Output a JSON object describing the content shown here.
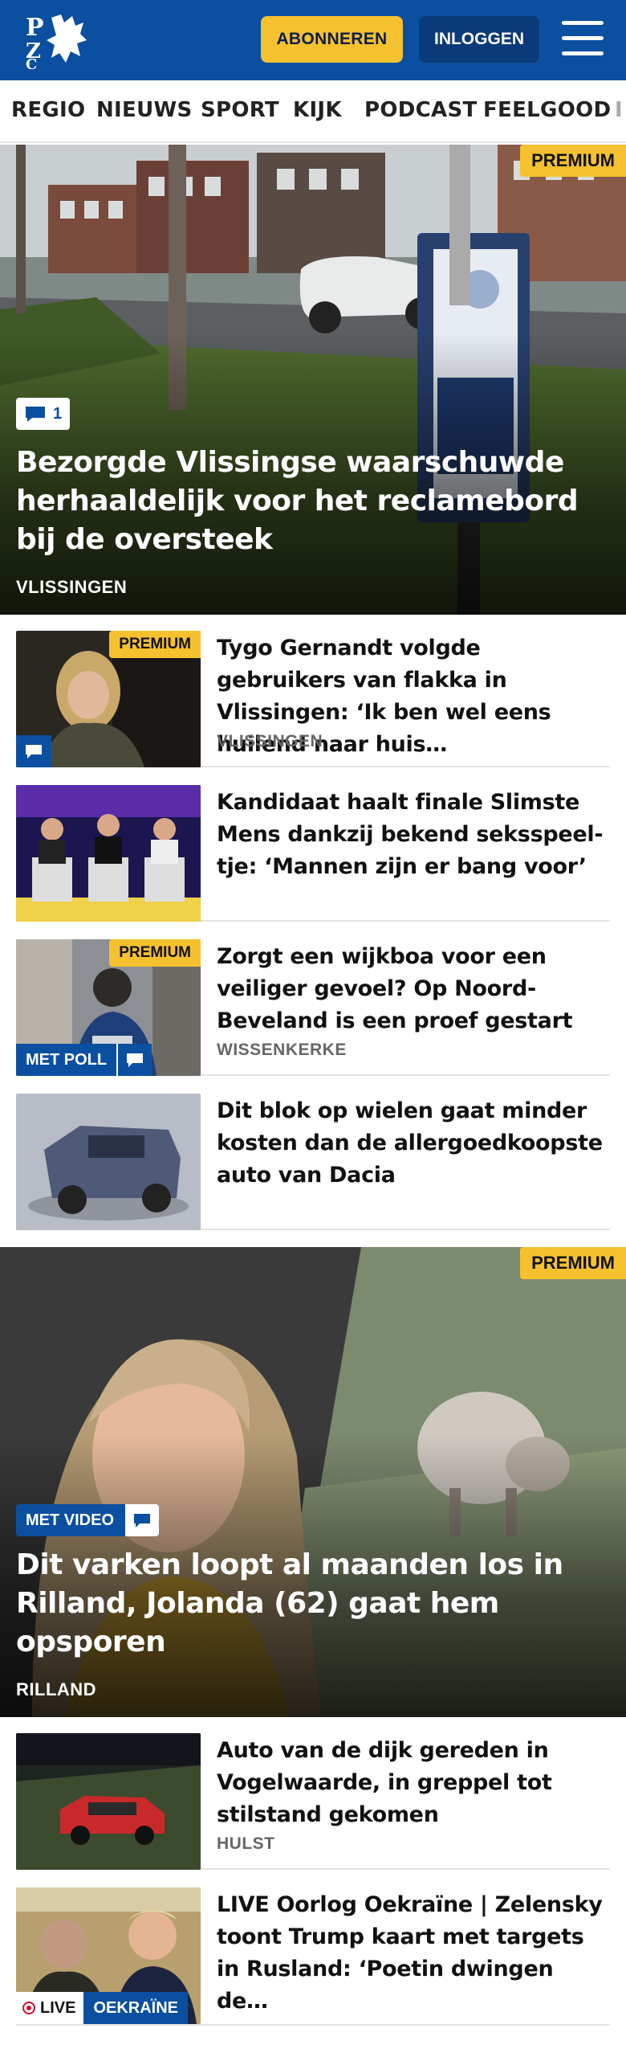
{
  "header": {
    "logo_text": "PZC",
    "subscribe_label": "ABONNEREN",
    "login_label": "INLOGGEN"
  },
  "nav": {
    "items": [
      "REGIO",
      "NIEUWS",
      "SPORT",
      "KIJK",
      "PODCAST",
      "FEELGOOD",
      "I"
    ]
  },
  "hero1": {
    "badge": "PREMIUM",
    "comment_count": "1",
    "title": "Bezorgde Vlissingse waarschuwde herhaaldelijk voor het reclamebord bij de oversteek",
    "region": "VLISSINGEN"
  },
  "articles": [
    {
      "badge": "PREMIUM",
      "title": "Tygo Gernandt volgde gebruikers van flakka in Vlissingen: ‘Ik ben wel eens huilend naar huis…",
      "region": "VLISSINGEN"
    },
    {
      "title": "Kandidaat haalt finale Slimste Mens dankzij bekend seksspeel­tje: ‘Mannen zijn er bang voor’"
    },
    {
      "badge": "PREMIUM",
      "tag": "MET POLL",
      "title": "Zorgt een wijkboa voor een veiliger gevoel? Op Noord-Beveland is een proef gestart",
      "region": "WISSENKERKE"
    },
    {
      "title": "Dit blok op wielen gaat minder kosten dan de allergoedkoopste auto van Dacia"
    }
  ],
  "hero2": {
    "badge": "PREMIUM",
    "tag": "MET VIDEO",
    "title": "Dit varken loopt al maanden los in Rilland, Jolanda (62) gaat hem opsporen",
    "region": "RILLAND"
  },
  "articles2": [
    {
      "title": "Auto van de dijk gereden in Vogelwaarde, in greppel tot stilstand gekomen",
      "region": "HULST"
    },
    {
      "title": "LIVE Oorlog Oekraïne | Zelensky toont Trump kaart met targets in Rusland: ‘Poetin dwingen de…",
      "live_label": "LIVE",
      "tag": "OEKRAÏNE"
    }
  ],
  "colors": {
    "brand_blue": "#0b4fa0",
    "accent_yellow": "#f6c12f",
    "live_red": "#d1102b"
  },
  "icons": [
    "hamburger-menu-icon",
    "comment-icon",
    "live-dot-icon"
  ]
}
